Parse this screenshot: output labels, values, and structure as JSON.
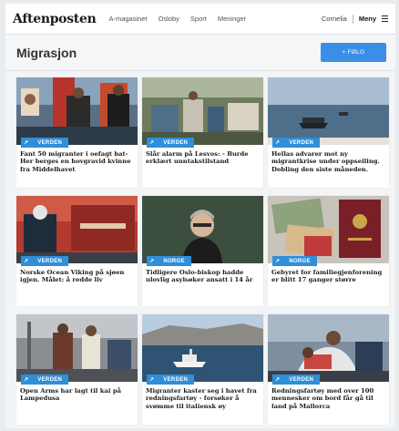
{
  "header": {
    "logo": "Aftenposten",
    "nav": [
      "A-magasinet",
      "Osloby",
      "Sport",
      "Meninger"
    ],
    "user": "Cornelia",
    "menu_label": "Meny"
  },
  "page": {
    "title": "Migrasjon",
    "follow_label": "+ FØLG"
  },
  "articles": [
    {
      "category": "VERDEN",
      "headline": "Fant 50 migranter i oefagt bat-Her berges en hovgravid kvinne fra Middelhavet"
    },
    {
      "category": "VERDEN",
      "headline": "Slår alarm på Lesvos: - Burde erklært unntakstilstand"
    },
    {
      "category": "VERDEN",
      "headline": "Hellas advarer mot ny migrantkrise under oppseiling. Dobling den siste måneden."
    },
    {
      "category": "VERDEN",
      "headline": "Norske Ocean Viking på sjøen igjen. Målet: å redde liv"
    },
    {
      "category": "NORGE",
      "headline": "Tidligere Oslo-biskop hadde ulovlig asylsøker ansatt i 14 år"
    },
    {
      "category": "NORGE",
      "headline": "Gebyret for familiegjenforening er blitt 17 ganger større"
    },
    {
      "category": "VERDEN",
      "headline": "Open Arms har lagt til kai på Lampedusa"
    },
    {
      "category": "VERDEN",
      "headline": "Migranter kaster seg i havet fra redningsfartøy - forsøker å svømme til italiensk øy"
    },
    {
      "category": "VERDEN",
      "headline": "Redningsfartøy med over 100 mennesker om bord får gå til land på Mallorca"
    }
  ],
  "colors": {
    "badge": "#2f8fd8",
    "follow_button": "#3b8ee6"
  }
}
